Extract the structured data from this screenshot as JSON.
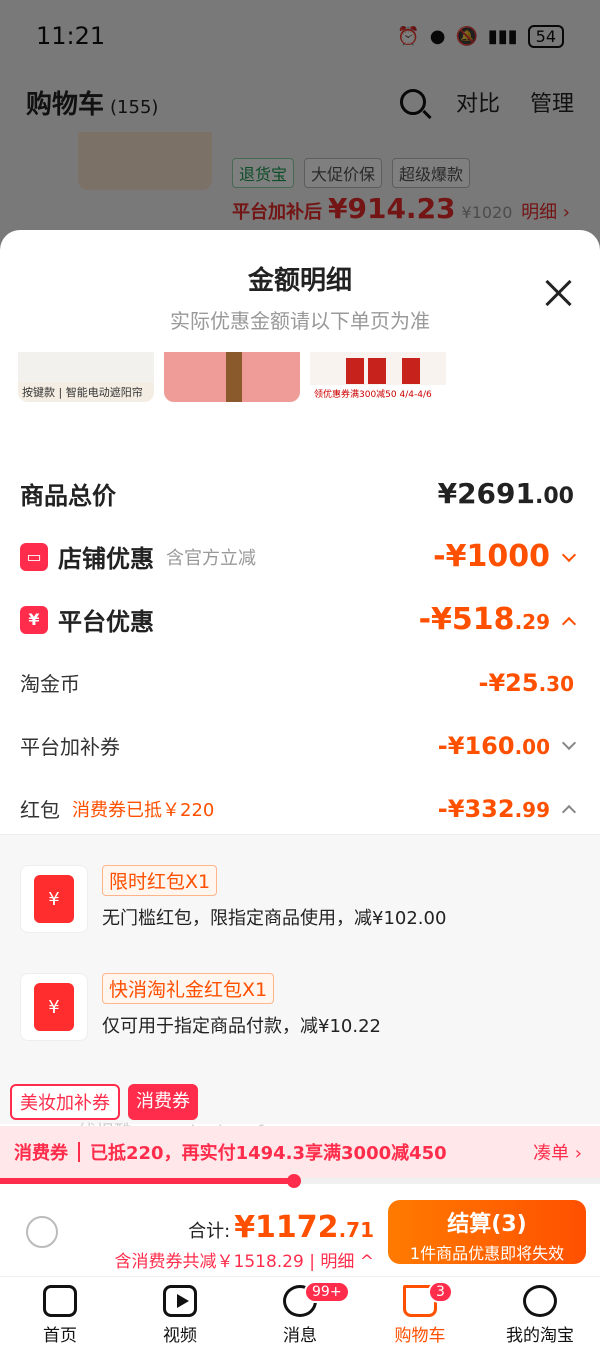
{
  "status": {
    "time": "11:21",
    "battery": "54"
  },
  "cart_header": {
    "title": "购物车",
    "count": "(155)",
    "compare": "对比",
    "manage": "管理"
  },
  "bg_product": {
    "tags": [
      "退货宝",
      "大促价保",
      "超级爆款"
    ],
    "price_label": "平台加补后",
    "price": "¥914.23",
    "original": "¥1020",
    "detail": "明细 ›"
  },
  "sheet": {
    "title": "金额明细",
    "subtitle": "实际优惠金额请以下单页为准",
    "thumbs": [
      {
        "caption": "按键款 | 智能电动遮阳帘"
      },
      {
        "caption": ""
      },
      {
        "caption": "领优惠券满300减50 4/4-4/6"
      }
    ],
    "rows": {
      "total": {
        "label": "商品总价",
        "value": "¥2691",
        "decimal": ".00"
      },
      "store": {
        "label": "店铺优惠",
        "hint": "含官方立减",
        "value": "-¥1000",
        "decimal": ""
      },
      "platform": {
        "label": "平台优惠",
        "value": "-¥518",
        "decimal": ".29"
      },
      "coins": {
        "label": "淘金币",
        "value": "-¥25",
        "decimal": ".30"
      },
      "subsidy": {
        "label": "平台加补券",
        "value": "-¥160",
        "decimal": ".00"
      },
      "redpacket": {
        "label": "红包",
        "hint": "消费券已抵￥220",
        "value": "-¥332",
        "decimal": ".99"
      }
    },
    "envelopes": [
      {
        "tag": "限时红包X1",
        "desc": "无门槛红包，限指定商品使用，减¥102.00",
        "icon": "¥"
      },
      {
        "tag": "快消淘礼金红包X1",
        "desc": "仅可用于指定商品付款，减¥10.22",
        "icon": "¥"
      }
    ],
    "promo_tags": [
      "美妆加补券",
      "消费券"
    ],
    "watermark": "线报酷-new.xianbao.fun"
  },
  "voucher_bar": {
    "label": "消费券",
    "message": "已抵220，再实付1494.3享满3000减450",
    "link": "凑单 ›",
    "progress": 0.49
  },
  "checkout": {
    "sum_label": "合计:",
    "sum_value": "¥1172",
    "sum_decimal": ".71",
    "sum_note": "含消费券共减￥1518.29 | 明细 ^",
    "pay_label": "结算(3)",
    "pay_sub": "1件商品优惠即将失效"
  },
  "tabbar": [
    {
      "label": "首页",
      "icon": "home-icon"
    },
    {
      "label": "视频",
      "icon": "video-icon"
    },
    {
      "label": "消息",
      "icon": "message-icon",
      "badge": "99+"
    },
    {
      "label": "购物车",
      "icon": "cart-icon",
      "badge": "3",
      "active": true
    },
    {
      "label": "我的淘宝",
      "icon": "profile-icon"
    }
  ],
  "colors": {
    "accent": "#ff5000",
    "brand_red": "#ff2d4b"
  }
}
